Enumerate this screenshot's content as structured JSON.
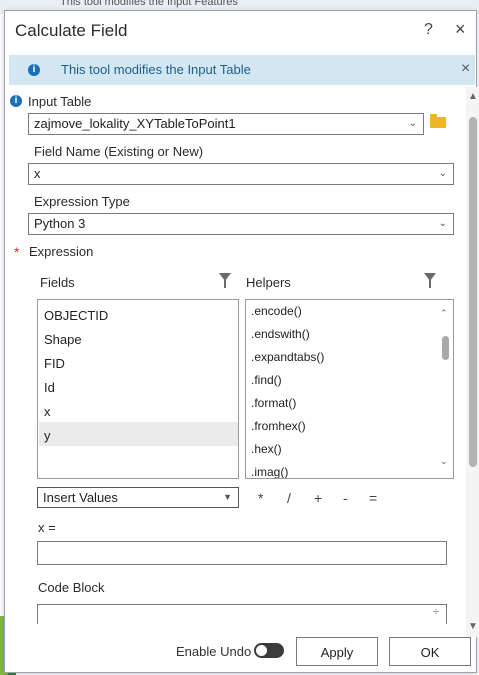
{
  "background": {
    "behind_window_text": "This tool modifies the Input Features"
  },
  "dialog": {
    "title": "Calculate Field",
    "help_glyph": "?",
    "close_glyph": "×"
  },
  "info_bar": {
    "icon": "info-icon",
    "message": "This tool modifies the Input Table",
    "close_glyph": "×"
  },
  "form": {
    "input_table": {
      "label": "Input Table",
      "value": "zajmove_lokality_XYTableToPoint1"
    },
    "field_name": {
      "label": "Field Name (Existing or New)",
      "value": "x"
    },
    "expression_type": {
      "label": "Expression Type",
      "value": "Python 3"
    },
    "expression": {
      "label": "Expression",
      "required_mark": "*"
    },
    "fields": {
      "label": "Fields",
      "items": [
        "OBJECTID",
        "Shape",
        "FID",
        "Id",
        "x",
        "y"
      ],
      "selected_index": 5
    },
    "helpers": {
      "label": "Helpers",
      "items": [
        ".encode()",
        ".endswith()",
        ".expandtabs()",
        ".find()",
        ".format()",
        ".fromhex()",
        ".hex()",
        ".imag()"
      ]
    },
    "insert_values": {
      "value": "Insert Values"
    },
    "operators": [
      "*",
      "/",
      "+",
      "-",
      "="
    ],
    "expression_prefix": "x =",
    "expression_value": "",
    "code_block": {
      "label": "Code Block",
      "value": ""
    }
  },
  "footer": {
    "enable_undo_label": "Enable Undo",
    "enable_undo_on": false,
    "apply_label": "Apply",
    "ok_label": "OK"
  }
}
